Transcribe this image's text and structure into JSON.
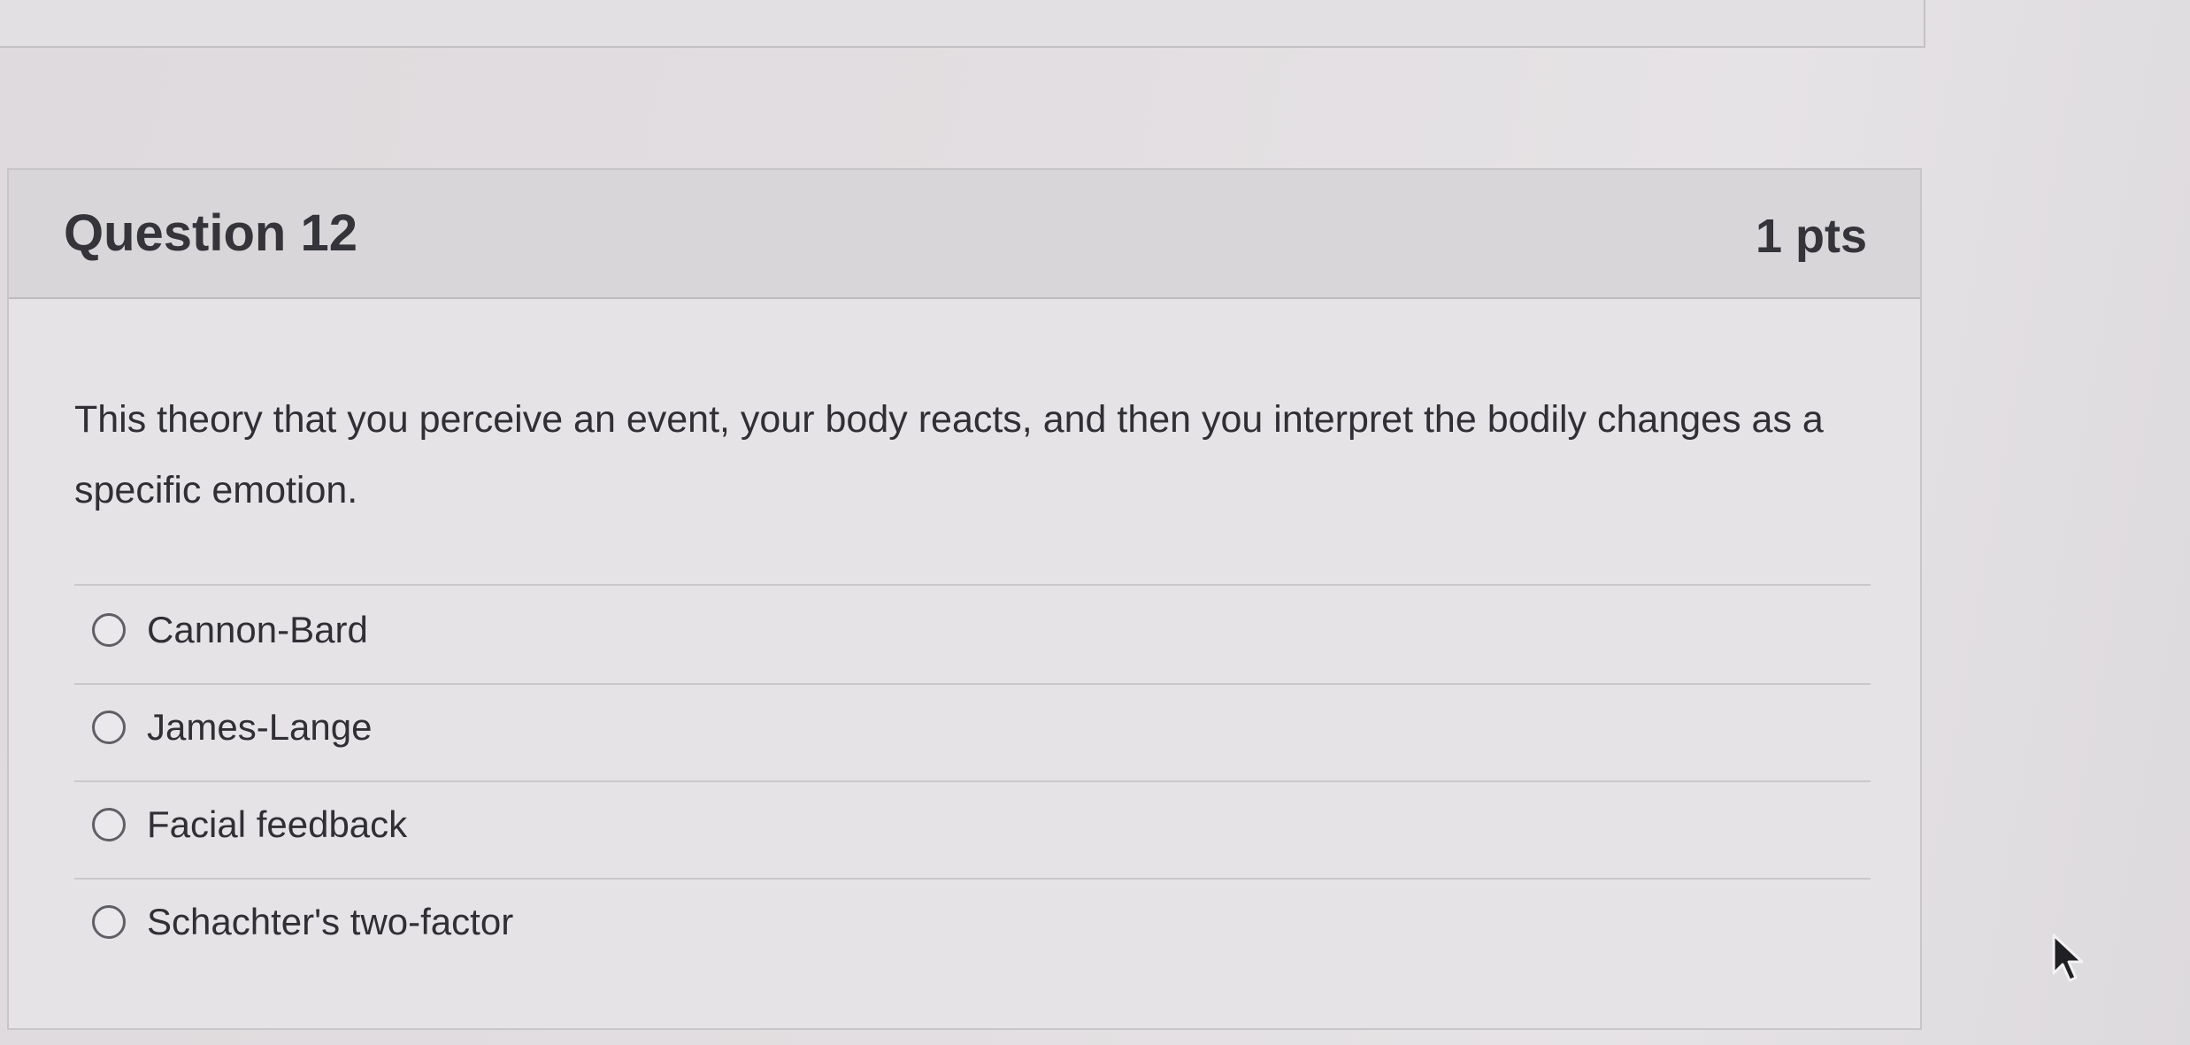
{
  "question": {
    "title": "Question 12",
    "points": "1 pts",
    "text": "This theory that you perceive an event, your body reacts, and then you interpret the bodily changes as a specific emotion."
  },
  "answers": [
    {
      "label": "Cannon-Bard",
      "selected": false
    },
    {
      "label": "James-Lange",
      "selected": false
    },
    {
      "label": "Facial feedback",
      "selected": false
    },
    {
      "label": "Schachter's two-factor",
      "selected": false
    }
  ],
  "icons": {
    "radio": "radio-unselected-icon",
    "cursor": "mouse-pointer-icon"
  },
  "colors": {
    "header_bg": "#d9d6d9",
    "text": "#2f2f35",
    "border": "#c9c6c9"
  }
}
